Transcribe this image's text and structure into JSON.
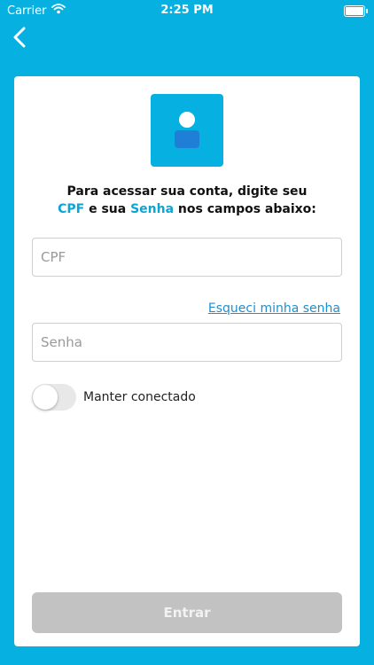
{
  "status_bar": {
    "carrier": "Carrier",
    "time": "2:25 PM",
    "wifi_icon": "wifi-icon",
    "battery_icon": "battery-icon"
  },
  "nav": {
    "back_icon": "chevron-left-icon"
  },
  "login": {
    "avatar_icon": "user-icon",
    "instruction_line1": "Para acessar sua conta, digite seu",
    "instruction_cpf": "CPF",
    "instruction_middle": " e sua ",
    "instruction_senha": "Senha",
    "instruction_end": " nos campos abaixo:",
    "cpf_placeholder": "CPF",
    "cpf_value": "",
    "forgot_label": "Esqueci minha senha",
    "senha_placeholder": "Senha",
    "senha_value": "",
    "keep_connected_label": "Manter conectado",
    "keep_connected": false,
    "submit_label": "Entrar"
  },
  "colors": {
    "background": "#06b0e0",
    "highlight": "#0aa5d2",
    "link": "#1d8fd0",
    "button_disabled": "#c2c2c2",
    "avatar_body": "#1f7fd6"
  }
}
